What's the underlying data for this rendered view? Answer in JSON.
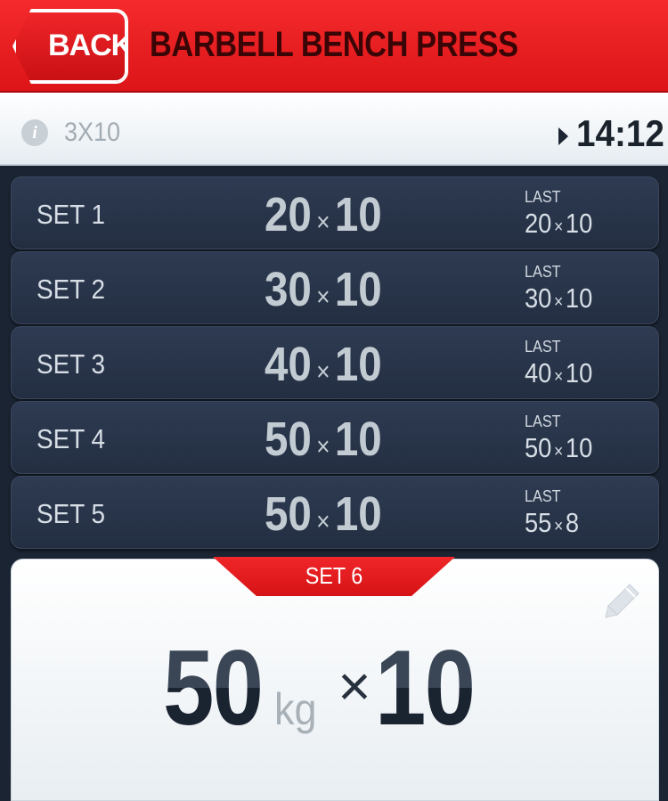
{
  "header": {
    "back_label": "BACK",
    "title": "BARBELL BENCH PRESS"
  },
  "info": {
    "info_icon": "info-icon",
    "prescription": "3X10",
    "timer_icon": "play-icon",
    "timer": "14:12"
  },
  "sets": [
    {
      "label": "SET 1",
      "weight": "20",
      "times": "×",
      "reps": "10",
      "last_label": "LAST",
      "last_weight": "20",
      "last_reps": "10"
    },
    {
      "label": "SET 2",
      "weight": "30",
      "times": "×",
      "reps": "10",
      "last_label": "LAST",
      "last_weight": "30",
      "last_reps": "10"
    },
    {
      "label": "SET 3",
      "weight": "40",
      "times": "×",
      "reps": "10",
      "last_label": "LAST",
      "last_weight": "40",
      "last_reps": "10"
    },
    {
      "label": "SET 4",
      "weight": "50",
      "times": "×",
      "reps": "10",
      "last_label": "LAST",
      "last_weight": "50",
      "last_reps": "10"
    },
    {
      "label": "SET 5",
      "weight": "50",
      "times": "×",
      "reps": "10",
      "last_label": "LAST",
      "last_weight": "55",
      "last_reps": "8"
    }
  ],
  "current": {
    "label": "SET 6",
    "weight": "50",
    "unit": "kg",
    "times": "×",
    "reps": "10",
    "edit_icon": "pencil-icon"
  },
  "colors": {
    "accent_red": "#e11b1e",
    "row_bg": "#27334a",
    "text_dark": "#1a222c"
  }
}
